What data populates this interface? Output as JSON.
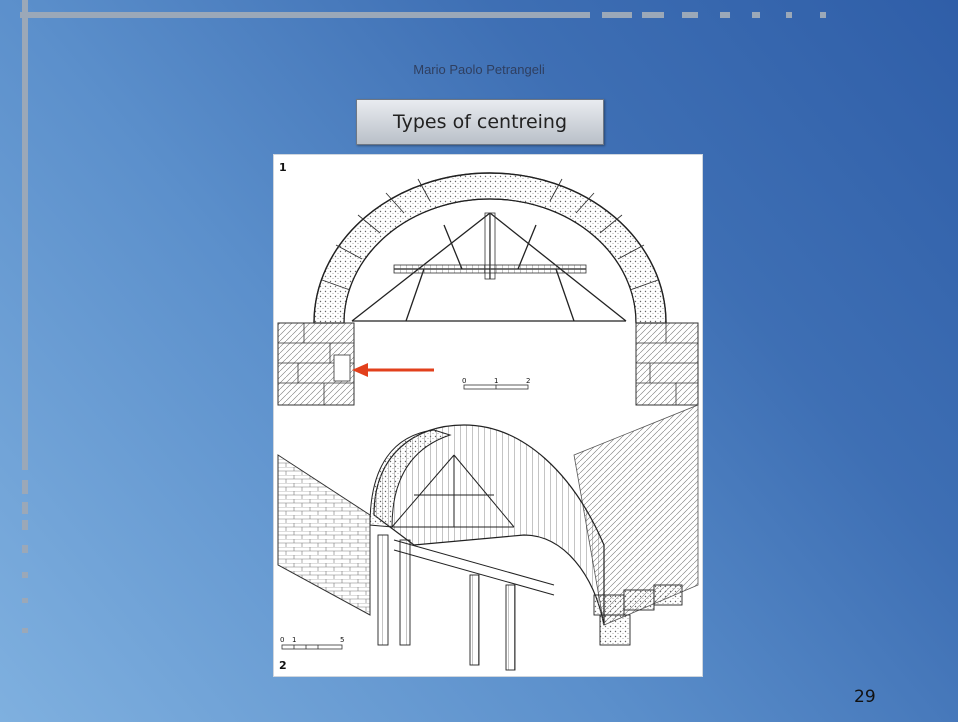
{
  "slide": {
    "author": "Mario Paolo Petrangeli",
    "title": "Types of centreing",
    "page_number": "29"
  },
  "figure": {
    "panel_1_label": "1",
    "panel_2_label": "2",
    "scale_1": {
      "ticks": [
        "0",
        "1",
        "2"
      ]
    },
    "scale_2": {
      "ticks": [
        "0",
        "1",
        "5"
      ]
    },
    "arrow_color": "#e2401c"
  },
  "colors": {
    "background": "#4a7fc1",
    "decor_bar": "#9ba8b8",
    "title_box": "#d9dde2"
  }
}
